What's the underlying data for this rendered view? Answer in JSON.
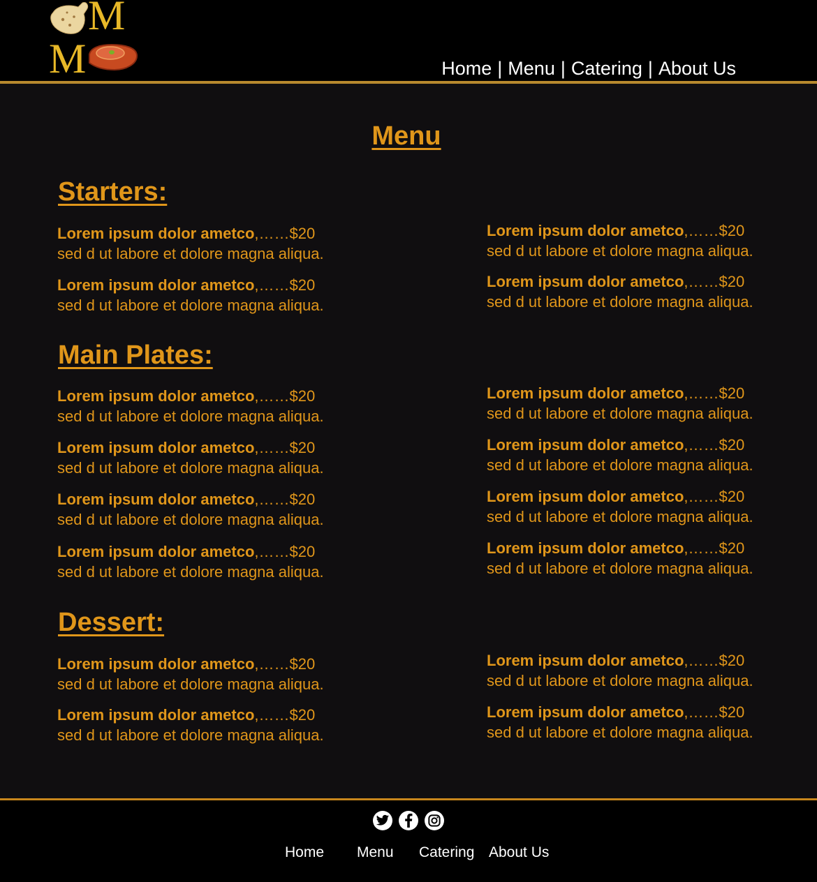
{
  "header": {
    "nav": [
      {
        "label": "Home"
      },
      {
        "label": "Menu"
      },
      {
        "label": "Catering"
      },
      {
        "label": "About Us"
      }
    ],
    "separator": "|"
  },
  "main": {
    "title": "Menu",
    "item_name": "Lorem ipsum dolor ametco",
    "item_price": ",……$20",
    "item_desc": "sed d ut labore et dolore magna aliqua.",
    "sections": [
      {
        "title": "Starters:",
        "item_count": 4
      },
      {
        "title": "Main Plates:",
        "item_count": 8
      },
      {
        "title": "Dessert:",
        "item_count": 4
      }
    ]
  },
  "footer": {
    "social": [
      {
        "name": "twitter-icon"
      },
      {
        "name": "facebook-icon"
      },
      {
        "name": "instagram-icon"
      }
    ],
    "nav": [
      {
        "label": "Home"
      },
      {
        "label": "Menu"
      },
      {
        "label": "Catering"
      },
      {
        "label": "About Us"
      }
    ]
  },
  "colors": {
    "accent": "#e0961a",
    "header_bg": "#000000",
    "page_bg": "#100e10",
    "divider": "#b8892e"
  }
}
